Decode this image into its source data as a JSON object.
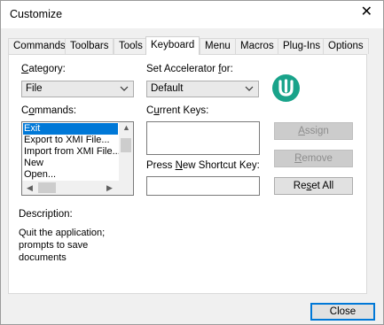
{
  "window": {
    "title": "Customize"
  },
  "tabs": [
    "Commands",
    "Toolbars",
    "Tools",
    "Keyboard",
    "Menu",
    "Macros",
    "Plug-Ins",
    "Options"
  ],
  "active_tab": "Keyboard",
  "category": {
    "label_pre": "",
    "label_key": "C",
    "label_post": "ategory:",
    "value": "File"
  },
  "accelerator": {
    "label_pre": "Set Accelerator ",
    "label_key": "f",
    "label_post": "or:",
    "value": "Default"
  },
  "commands": {
    "label_pre": "C",
    "label_key": "o",
    "label_post": "mmands:",
    "items": [
      "Exit",
      "Export to XMI File...",
      "Import from XMI File...",
      "New",
      "Open..."
    ],
    "selected": "Exit"
  },
  "current_keys": {
    "label_pre": "C",
    "label_key": "u",
    "label_post": "rrent Keys:"
  },
  "shortcut": {
    "label_pre": "Press ",
    "label_key": "N",
    "label_post": "ew Shortcut Key:",
    "value": ""
  },
  "buttons": {
    "assign": {
      "pre": "",
      "key": "A",
      "post": "ssign",
      "enabled": false
    },
    "remove": {
      "pre": "",
      "key": "R",
      "post": "emove",
      "enabled": false
    },
    "reset_all": {
      "pre": "Re",
      "key": "s",
      "post": "et All",
      "enabled": true
    },
    "close": "Close"
  },
  "description": {
    "label": "Description:",
    "text": "Quit the application; prompts to save documents"
  },
  "colors": {
    "accent": "#0078d7",
    "logo": "#19a38a",
    "selection": "#0078d7"
  },
  "icons": [
    "close-icon",
    "chevron-down-icon",
    "chevron-up-icon",
    "chevron-left-icon",
    "chevron-right-icon",
    "app-logo-icon"
  ]
}
